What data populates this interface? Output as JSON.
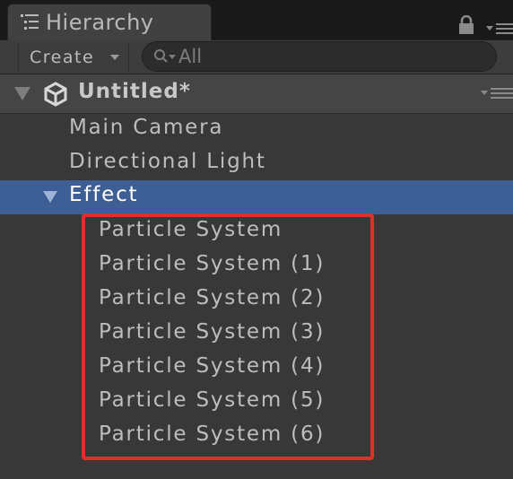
{
  "tab": {
    "label": "Hierarchy",
    "icon": "hierarchy-list-icon"
  },
  "header_icons": [
    "lock-icon",
    "tab-menu-icon"
  ],
  "toolbar": {
    "create_label": "Create",
    "search": {
      "value": "",
      "placeholder": "All",
      "icon": "search-icon"
    }
  },
  "scene": {
    "name": "Untitled*",
    "icon": "unity-logo-icon",
    "expanded": true
  },
  "items": [
    {
      "label": "Main Camera"
    },
    {
      "label": "Directional Light"
    },
    {
      "label": "Effect",
      "selected": true,
      "expanded": true,
      "children": [
        {
          "label": "Particle System"
        },
        {
          "label": "Particle System (1)"
        },
        {
          "label": "Particle System (2)"
        },
        {
          "label": "Particle System (3)"
        },
        {
          "label": "Particle System (4)"
        },
        {
          "label": "Particle System (5)"
        },
        {
          "label": "Particle System (6)"
        }
      ]
    }
  ],
  "colors": {
    "background": "#383838",
    "selection": "#3e5f96",
    "highlight_outline": "#e0302b",
    "text": "#bdbdbd"
  }
}
